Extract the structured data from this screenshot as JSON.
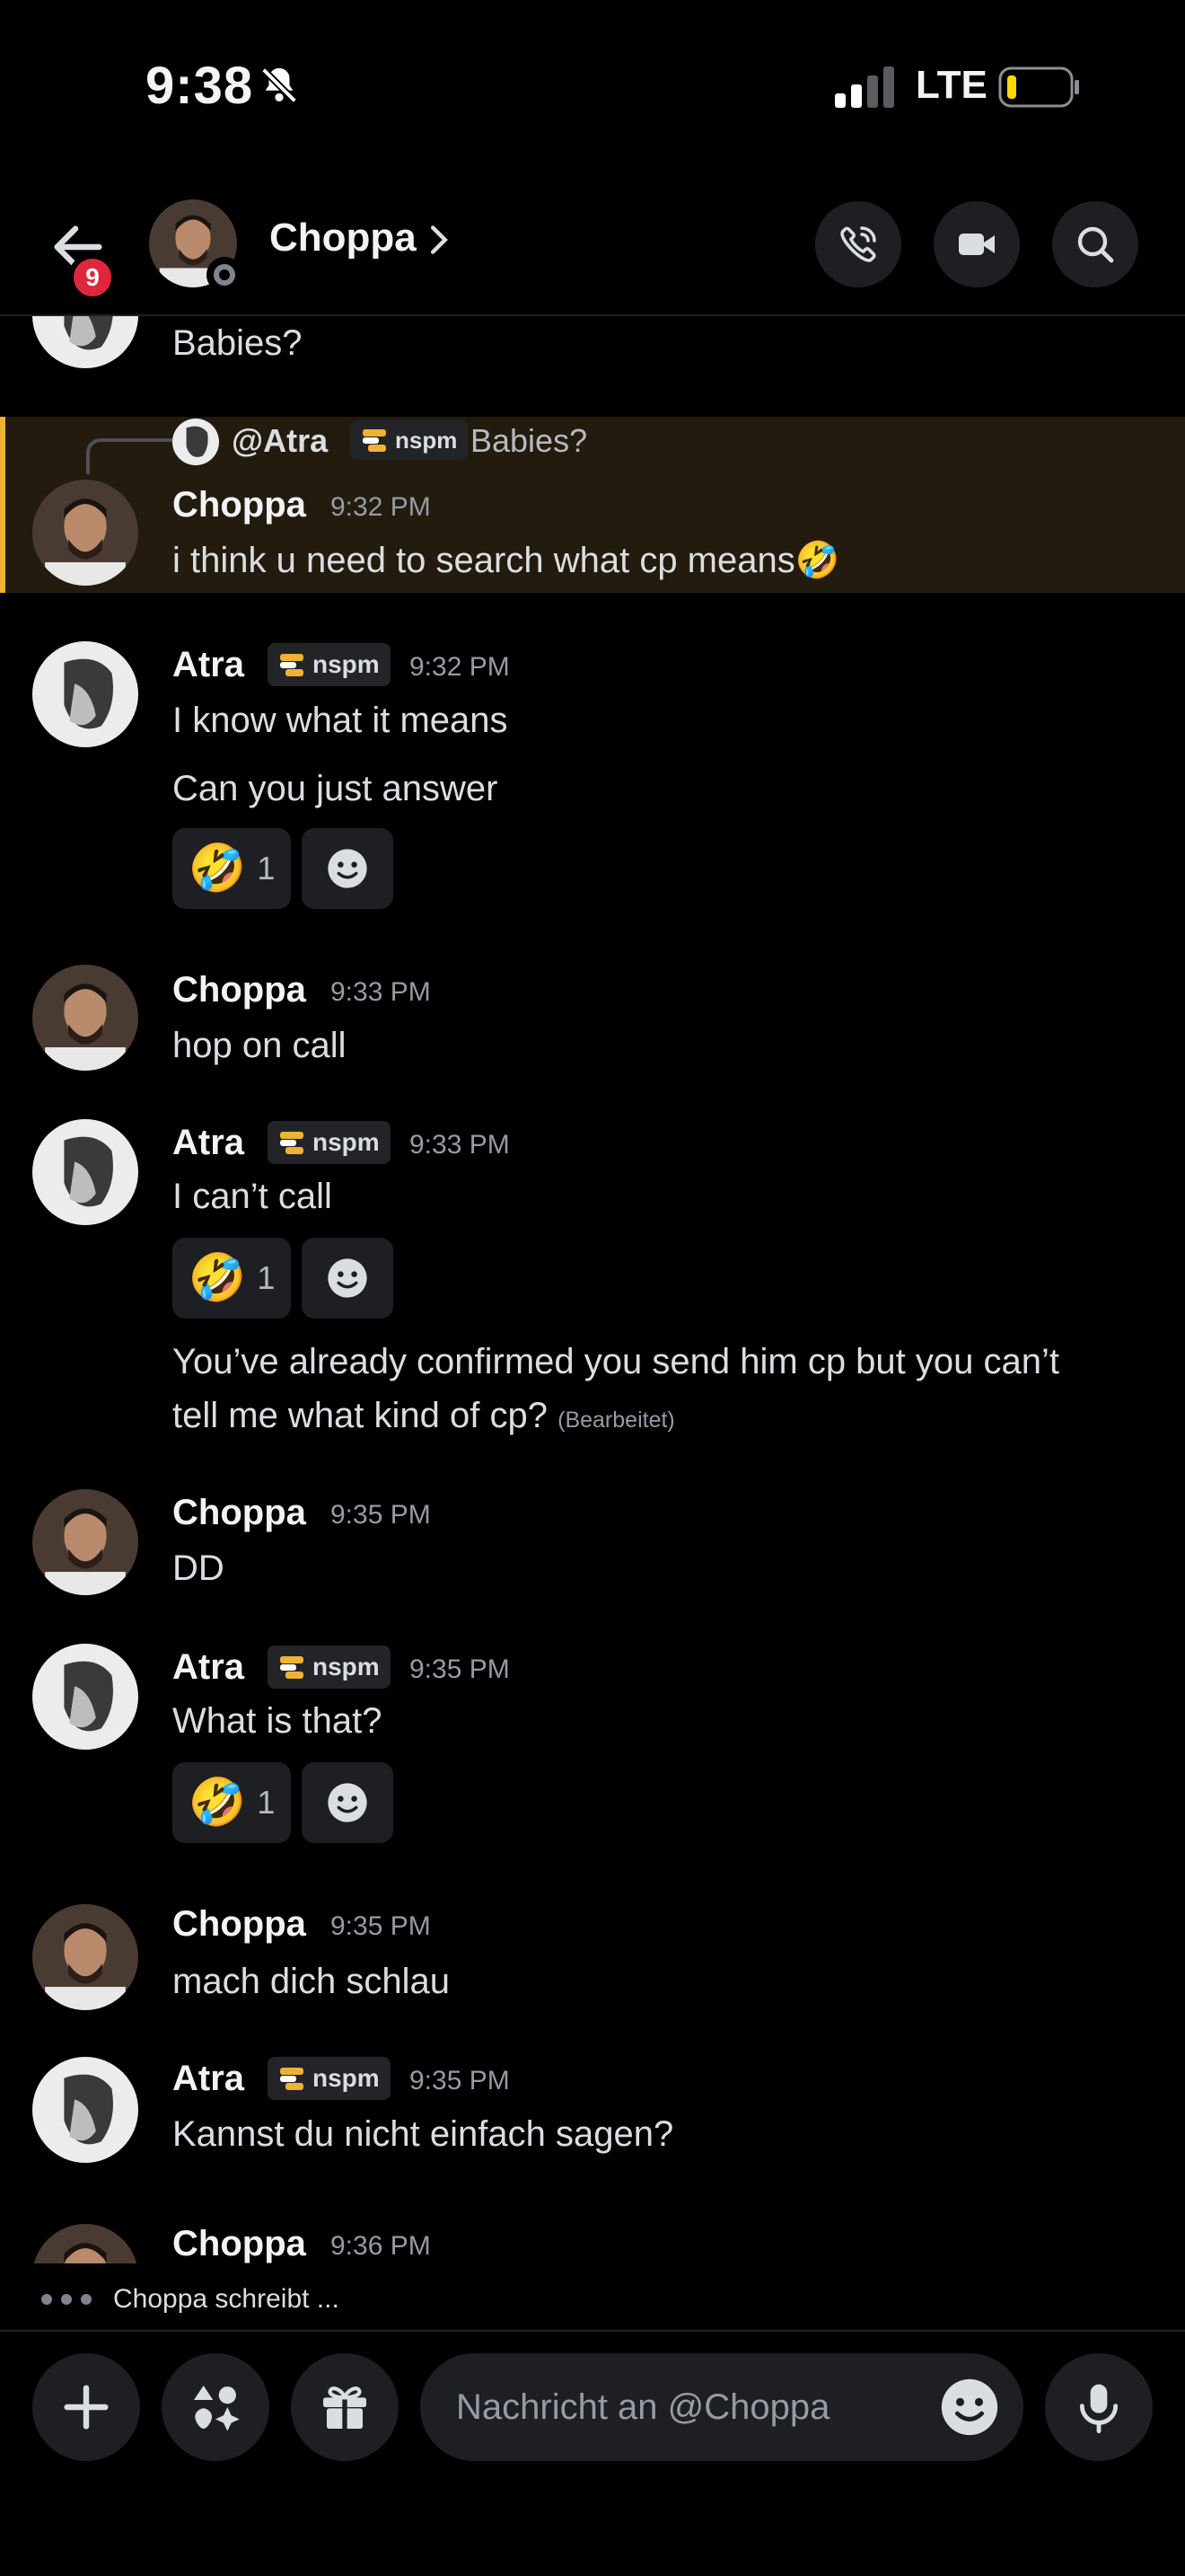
{
  "status_bar": {
    "time": "9:38",
    "network": "LTE"
  },
  "header": {
    "unread_count": "9",
    "name": "Choppa"
  },
  "reply": {
    "name": "@Atra",
    "tag": "nspm",
    "text": "Babies?"
  },
  "messages": [
    {
      "type": "partial",
      "text": "Babies?"
    },
    {
      "author": "Choppa",
      "time": "9:32 PM",
      "lines": [
        "i think u need to search what cp means🤣"
      ]
    },
    {
      "author": "Atra",
      "tag": "nspm",
      "time": "9:32 PM",
      "lines": [
        "I know what it means",
        "Can you just answer"
      ],
      "reaction": {
        "emoji": "🤣",
        "count": "1"
      }
    },
    {
      "author": "Choppa",
      "time": "9:33 PM",
      "lines": [
        "hop on call"
      ]
    },
    {
      "author": "Atra",
      "tag": "nspm",
      "time": "9:33 PM",
      "lines": [
        "I can’t call"
      ],
      "reaction": {
        "emoji": "🤣",
        "count": "1"
      }
    },
    {
      "author": "Atra",
      "type": "continuation",
      "lines": [
        "You’ve already confirmed you send him cp but you can’t",
        "tell me what kind of cp?"
      ],
      "edited": "(Bearbeitet)"
    },
    {
      "author": "Choppa",
      "time": "9:35 PM",
      "lines": [
        "DD"
      ]
    },
    {
      "author": "Atra",
      "tag": "nspm",
      "time": "9:35 PM",
      "lines": [
        "What is that?"
      ],
      "reaction": {
        "emoji": "🤣",
        "count": "1"
      }
    },
    {
      "author": "Choppa",
      "time": "9:35 PM",
      "lines": [
        "mach dich schlau"
      ]
    },
    {
      "author": "Atra",
      "tag": "nspm",
      "time": "9:35 PM",
      "lines": [
        "Kannst du nicht einfach sagen?"
      ]
    },
    {
      "author": "Choppa",
      "time": "9:36 PM",
      "lines": []
    }
  ],
  "typing": {
    "text": "Choppa schreibt ..."
  },
  "composer": {
    "placeholder": "Nachricht an @Choppa"
  },
  "colors": {
    "highlight_bar": "#f0b232",
    "highlight_bg": "#231c0e",
    "badge": "#e0263c",
    "background": "#000000"
  },
  "icons": [
    "back-arrow-icon",
    "phone-call-icon",
    "video-camera-icon",
    "search-icon",
    "plus-icon",
    "apps-icon",
    "gift-icon",
    "emoji-icon",
    "microphone-icon",
    "bell-muted-icon"
  ]
}
